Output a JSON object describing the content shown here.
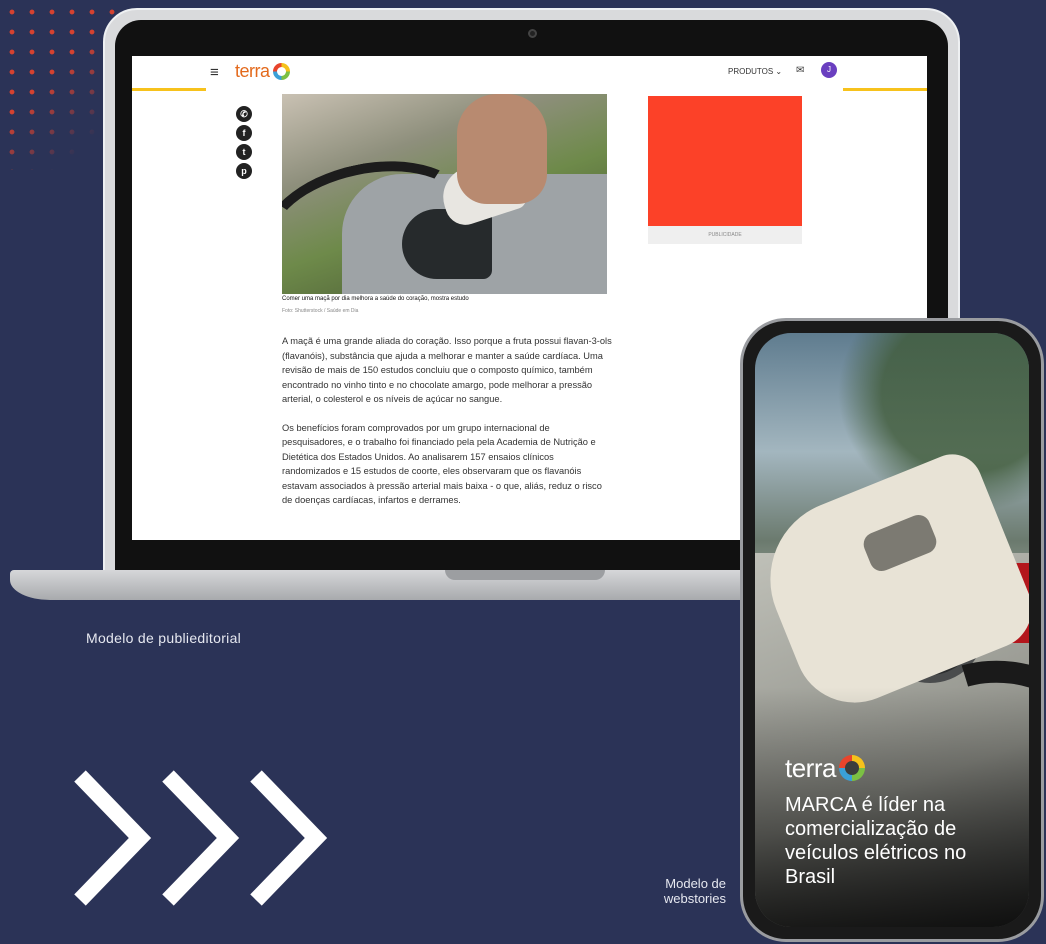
{
  "laptop": {
    "brand": "terra",
    "menu_glyph": "≡",
    "products_label": "PRODUTOS ⌄",
    "mail_glyph": "✉",
    "avatar_initial": "J",
    "share_icons": [
      "whatsapp-icon",
      "facebook-icon",
      "twitter-icon",
      "pinterest-icon"
    ],
    "caption": "Comer uma maçã por dia melhora a saúde do coração, mostra estudo",
    "credit": "Foto: Shutterstock / Saúde em Dia",
    "paragraphs": [
      "A maçã é uma grande aliada do coração. Isso porque a fruta possui flavan-3-ols (flavanóis), substância que ajuda a melhorar e manter a saúde cardíaca. Uma revisão de mais de 150 estudos concluiu que o composto químico, também encontrado no vinho tinto e no chocolate amargo, pode melhorar a pressão arterial, o colesterol e os níveis de açúcar no sangue.",
      "Os benefícios foram comprovados por um grupo internacional de pesquisadores, e o trabalho foi financiado pela pela Academia de Nutrição e Dietética dos Estados Unidos. Ao analisarem 157 ensaios clínicos randomizados e 15 estudos de coorte, eles observaram que os flavanóis estavam associados à pressão arterial mais baixa - o que, aliás, reduz o risco de doenças cardíacas, infartos e derrames."
    ],
    "ad_label": "PUBLICIDADE",
    "ad_color": "#fc4128"
  },
  "labels": {
    "laptop": "Modelo de publieditorial",
    "phone": "Modelo de webstories"
  },
  "phone": {
    "brand": "terra",
    "headline": "MARCA é líder na comercialização de veículos elétricos no Brasil"
  },
  "colors": {
    "background": "#2b3357",
    "accent_orange": "#e36a1d",
    "accent_yellow": "#f7c21c"
  }
}
